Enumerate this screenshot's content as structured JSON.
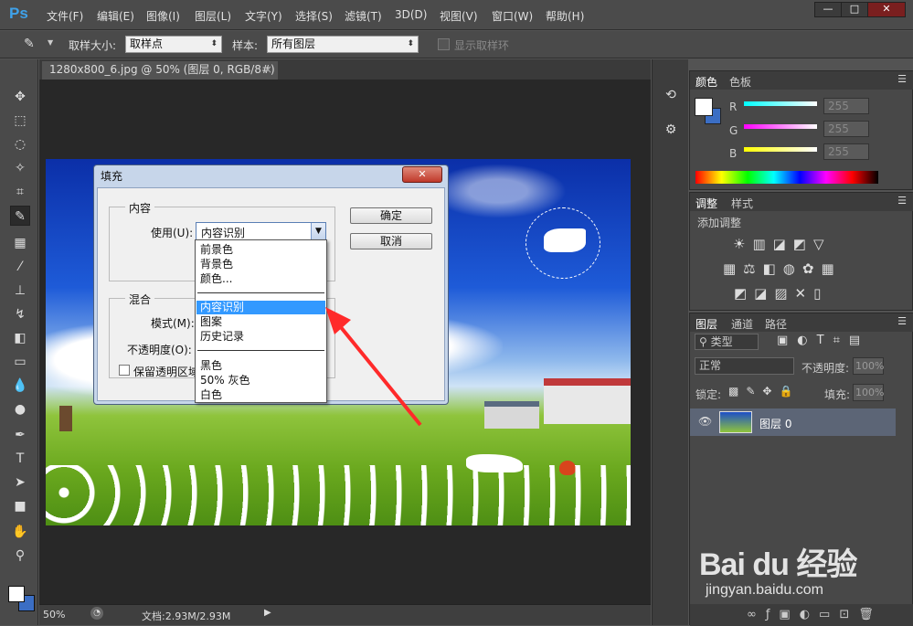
{
  "app": {
    "logo": "Ps"
  },
  "menu": [
    "文件(F)",
    "编辑(E)",
    "图像(I)",
    "图层(L)",
    "文字(Y)",
    "选择(S)",
    "滤镜(T)",
    "3D(D)",
    "视图(V)",
    "窗口(W)",
    "帮助(H)"
  ],
  "window_controls": {
    "minimize": "—",
    "maximize": "□",
    "close": "✕"
  },
  "options": {
    "sample_size_label": "取样大小:",
    "sample_size_value": "取样点",
    "sample_label": "样本:",
    "sample_value": "所有图层",
    "show_ring_label": "显示取样环"
  },
  "document": {
    "tab_title": "1280x800_6.jpg @ 50% (图层 0, RGB/8#) *",
    "zoom": "50%",
    "doc_size": "文档:2.93M/2.93M"
  },
  "color_panel": {
    "tabs": [
      "颜色",
      "色板"
    ],
    "channels": [
      {
        "label": "R",
        "value": "255"
      },
      {
        "label": "G",
        "value": "255"
      },
      {
        "label": "B",
        "value": "255"
      }
    ],
    "fg_color": "#ffffff",
    "bg_color": "#3b6ec4"
  },
  "adjust_panel": {
    "tabs": [
      "调整",
      "样式"
    ],
    "hint": "添加调整"
  },
  "layers_panel": {
    "tabs": [
      "图层",
      "通道",
      "路径"
    ],
    "filter_label": "类型",
    "blend_mode": "正常",
    "opacity_label": "不透明度:",
    "opacity_value": "100%",
    "lock_label": "锁定:",
    "fill_label": "填充:",
    "fill_value": "100%",
    "layers": [
      {
        "name": "图层 0"
      }
    ]
  },
  "dialog": {
    "title": "填充",
    "content_group": "内容",
    "use_label": "使用(U):",
    "use_value": "内容识别",
    "ok": "确定",
    "cancel": "取消",
    "blend_group": "混合",
    "mode_label": "模式(M):",
    "opacity_label": "不透明度(O):",
    "preserve_label": "保留透明区域",
    "options": [
      [
        "前景色",
        "背景色",
        "颜色..."
      ],
      [
        "内容识别",
        "图案",
        "历史记录"
      ],
      [
        "黑色",
        "50% 灰色",
        "白色"
      ]
    ],
    "selected": "内容识别"
  },
  "watermark": {
    "brand": "Bai du 经验",
    "url": "jingyan.baidu.com"
  }
}
